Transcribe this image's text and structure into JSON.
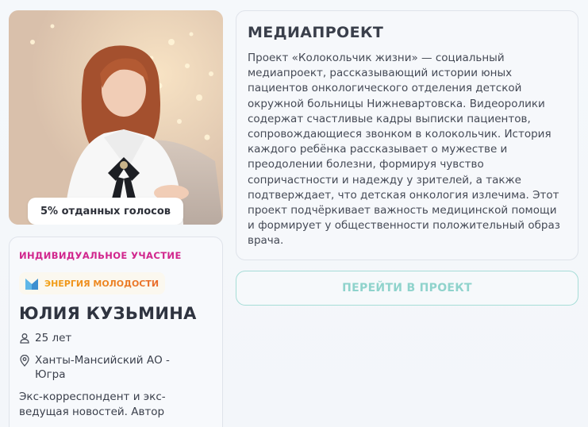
{
  "photo": {
    "votes_label": "5% отданных голосов"
  },
  "participant": {
    "category": "ИНДИВИДУАЛЬНОЕ УЧАСТИЕ",
    "organization": "ЭНЕРГИЯ МОЛОДОСТИ",
    "name": "ЮЛИЯ КУЗЬМИНА",
    "age": "25 лет",
    "region": "Ханты-Мансийский АО - Югра",
    "bio": "Экс-корреспондент и экс-ведущая новостей. Автор"
  },
  "media_project": {
    "title": "МЕДИАПРОЕКТ",
    "description": "Проект «Колокольчик жизни» — социальный медиапроект, рассказывающий истории юных пациентов онкологического отделения детской окружной больницы Нижневартовска. Видеоролики содержат счастливые кадры выписки пациентов, сопровождающиеся звонком в колокольчик. История каждого ребёнка рассказывает о мужестве и преодолении болезни, формируя чувство сопричастности и надежду у зрителей, а также подтверждает, что детская онкология излечима. Этот проект подчёркивает важность медицинской помощи и формирует у общественности положительный образ врача.",
    "button_label": "ПЕРЕЙТИ В ПРОЕКТ"
  },
  "colors": {
    "category": "#d1268d",
    "button_text": "#8fd3cc",
    "button_border": "#a6ddd7",
    "org_gradient_start": "#f2a114",
    "org_gradient_end": "#e86b2c"
  }
}
